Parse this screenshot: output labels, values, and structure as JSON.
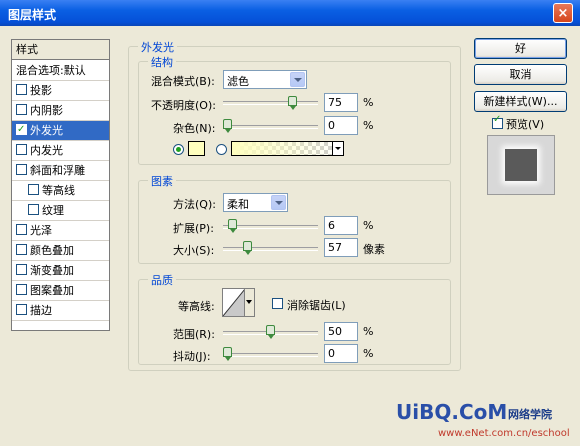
{
  "window": {
    "title": "图层样式",
    "close_glyph": "×"
  },
  "sidebar": {
    "header": "样式",
    "items": [
      {
        "label": "混合选项:默认",
        "checkbox": false,
        "checked": false,
        "selected": false,
        "sub": false
      },
      {
        "label": "投影",
        "checkbox": true,
        "checked": false,
        "selected": false,
        "sub": false
      },
      {
        "label": "内阴影",
        "checkbox": true,
        "checked": false,
        "selected": false,
        "sub": false
      },
      {
        "label": "外发光",
        "checkbox": true,
        "checked": true,
        "selected": true,
        "sub": false
      },
      {
        "label": "内发光",
        "checkbox": true,
        "checked": false,
        "selected": false,
        "sub": false
      },
      {
        "label": "斜面和浮雕",
        "checkbox": true,
        "checked": false,
        "selected": false,
        "sub": false
      },
      {
        "label": "等高线",
        "checkbox": true,
        "checked": false,
        "selected": false,
        "sub": true
      },
      {
        "label": "纹理",
        "checkbox": true,
        "checked": false,
        "selected": false,
        "sub": true
      },
      {
        "label": "光泽",
        "checkbox": true,
        "checked": false,
        "selected": false,
        "sub": false
      },
      {
        "label": "颜色叠加",
        "checkbox": true,
        "checked": false,
        "selected": false,
        "sub": false
      },
      {
        "label": "渐变叠加",
        "checkbox": true,
        "checked": false,
        "selected": false,
        "sub": false
      },
      {
        "label": "图案叠加",
        "checkbox": true,
        "checked": false,
        "selected": false,
        "sub": false
      },
      {
        "label": "描边",
        "checkbox": true,
        "checked": false,
        "selected": false,
        "sub": false
      }
    ]
  },
  "main": {
    "title": "外发光",
    "structure": {
      "label": "结构",
      "blend_mode_label": "混合模式(B):",
      "blend_mode_value": "滤色",
      "opacity_label": "不透明度(O):",
      "opacity_value": "75",
      "opacity_unit": "%",
      "opacity_level": 75,
      "noise_label": "杂色(N):",
      "noise_value": "0",
      "noise_unit": "%",
      "noise_level": 0,
      "color_swatch": "#ffffbe"
    },
    "elements": {
      "label": "图素",
      "method_label": "方法(Q):",
      "method_value": "柔和",
      "spread_label": "扩展(P):",
      "spread_value": "6",
      "spread_unit": "%",
      "spread_level": 6,
      "size_label": "大小(S):",
      "size_value": "57",
      "size_unit": "像素",
      "size_level": 23
    },
    "quality": {
      "label": "品质",
      "contour_label": "等高线:",
      "antialias_label": "消除锯齿(L)",
      "antialias_checked": false,
      "range_label": "范围(R):",
      "range_value": "50",
      "range_unit": "%",
      "range_level": 50,
      "jitter_label": "抖动(J):",
      "jitter_value": "0",
      "jitter_unit": "%",
      "jitter_level": 0
    }
  },
  "buttons": {
    "ok": "好",
    "cancel": "取消",
    "new_style": "新建样式(W)...",
    "preview_label": "预览(V)",
    "preview_checked": true
  },
  "watermark": {
    "logo": "UiBQ.CoM",
    "tagline": "网络学院",
    "url": "www.eNet.com.cn/eschool"
  }
}
